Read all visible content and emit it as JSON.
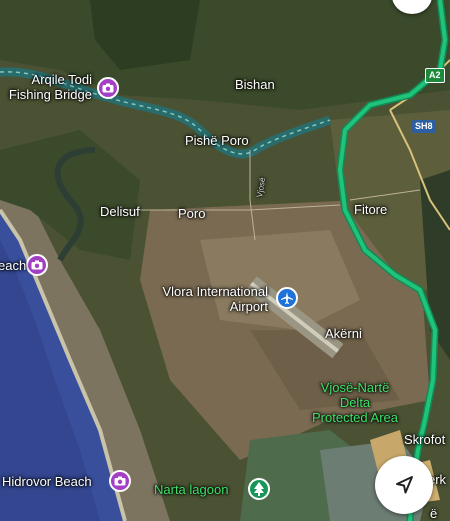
{
  "places": {
    "arqile_todi": "Arqile Todi\nFishing Bridge",
    "bishan": "Bishan",
    "pishe_poro": "Pishë Poro",
    "fitore": "Fitore",
    "delisuf": "Delisuf",
    "poro": "Poro",
    "beach_partial": "each",
    "airport": "Vlora International\nAirport",
    "akerni": "Akërni",
    "delta": "Vjosë-Nartë\nDelta\nProtected Area",
    "skrofotine_partial": "Skrofot",
    "hidrovor_beach": "Hidrovor Beach",
    "narta_lagoon": "Narta lagoon",
    "road_partial": "Vjosë",
    "bottom_right_partial": "erk",
    "bottom_right_partial2": "ë"
  },
  "road_shields": {
    "a2": "A2",
    "sh8": "SH8"
  },
  "icons": {
    "attraction": "camera-icon",
    "airport": "airplane-icon",
    "park": "tree-icon",
    "navigation": "navigation-arrow-icon"
  },
  "colors": {
    "route": "#1fc47a",
    "river": "#2a6b6b",
    "sea": "#3a4f9c",
    "poi_purple": "#a33fc4",
    "poi_blue": "#1e72d8",
    "poi_green": "#18965a"
  }
}
